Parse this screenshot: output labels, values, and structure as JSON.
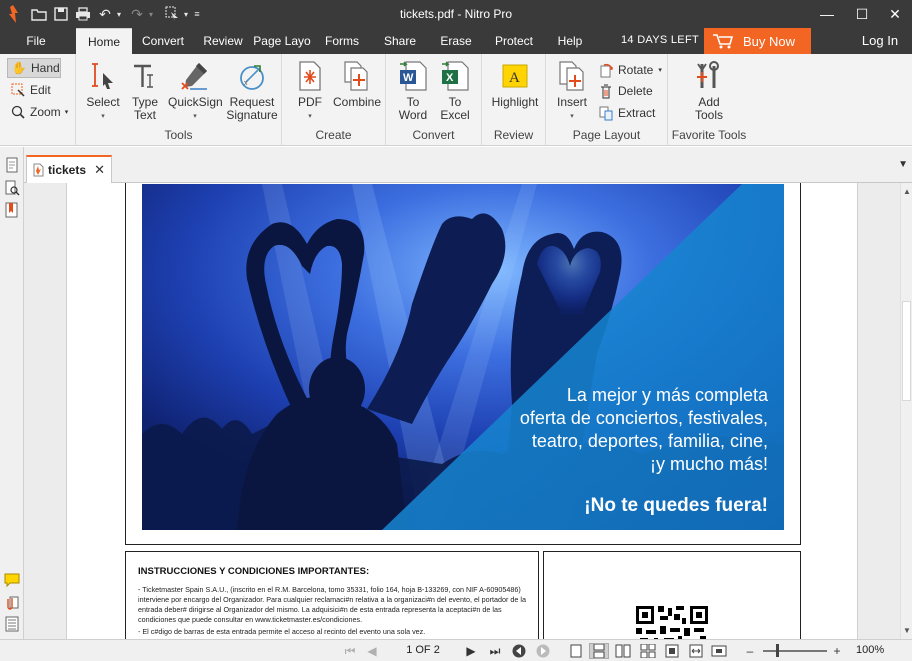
{
  "window": {
    "title": "tickets.pdf - Nitro Pro"
  },
  "menubar": {
    "file": "File",
    "tabs": [
      "Home",
      "Convert",
      "Review",
      "Page Layo",
      "Forms",
      "Share",
      "Erase",
      "Protect",
      "Help"
    ],
    "active_tab": "Home",
    "trial": "14 DAYS LEFT",
    "buy_now": "Buy Now",
    "login": "Log In"
  },
  "ribbon": {
    "nav": {
      "hand": "Hand",
      "edit": "Edit",
      "zoom": "Zoom"
    },
    "tools": {
      "label": "Tools",
      "select": "Select",
      "type_text_1": "Type",
      "type_text_2": "Text",
      "quicksign": "QuickSign",
      "request_sig_1": "Request",
      "request_sig_2": "Signature"
    },
    "create": {
      "label": "Create",
      "pdf": "PDF",
      "combine": "Combine"
    },
    "convert": {
      "label": "Convert",
      "to_word_1": "To",
      "to_word_2": "Word",
      "to_excel_1": "To",
      "to_excel_2": "Excel"
    },
    "review": {
      "label": "Review",
      "highlight": "Highlight"
    },
    "page_layout": {
      "label": "Page Layout",
      "insert": "Insert",
      "rotate": "Rotate",
      "delete": "Delete",
      "extract": "Extract"
    },
    "favorite_tools": {
      "label": "Favorite Tools",
      "add_1": "Add",
      "add_2": "Tools"
    }
  },
  "document_tab": {
    "name": "tickets"
  },
  "document": {
    "banner_lines": [
      "La mejor y más completa",
      "oferta de conciertos, festivales,",
      "teatro, deportes, familia, cine,",
      "¡y mucho más!"
    ],
    "banner_cta": "¡No te quedes fuera!",
    "instructions_title": "INSTRUCCIONES Y CONDICIONES IMPORTANTES:",
    "instructions_p1": "- Ticketmaster Spain S.A.U., (inscrito en el R.M. Barcelona, tomo 35331, folio 164, hoja B-133269, con NIF A-60905486) interviene por encargo del Organizador. Para cualquier reclamaci#n relativa a la organizaci#n del evento, el portador de la entrada deber# dirigirse al Organizador del mismo. La adquisici#n de esta entrada representa la aceptaci#n de las condiciones que puede consultar en www.ticketmaster.es/condiciones.",
    "instructions_p2": "- El c#digo de barras de esta entrada permite el acceso al recinto del evento una sola vez."
  },
  "statusbar": {
    "page_indicator": "1 OF 2",
    "zoom": "100%",
    "zoom_level_fraction": 0.22
  }
}
